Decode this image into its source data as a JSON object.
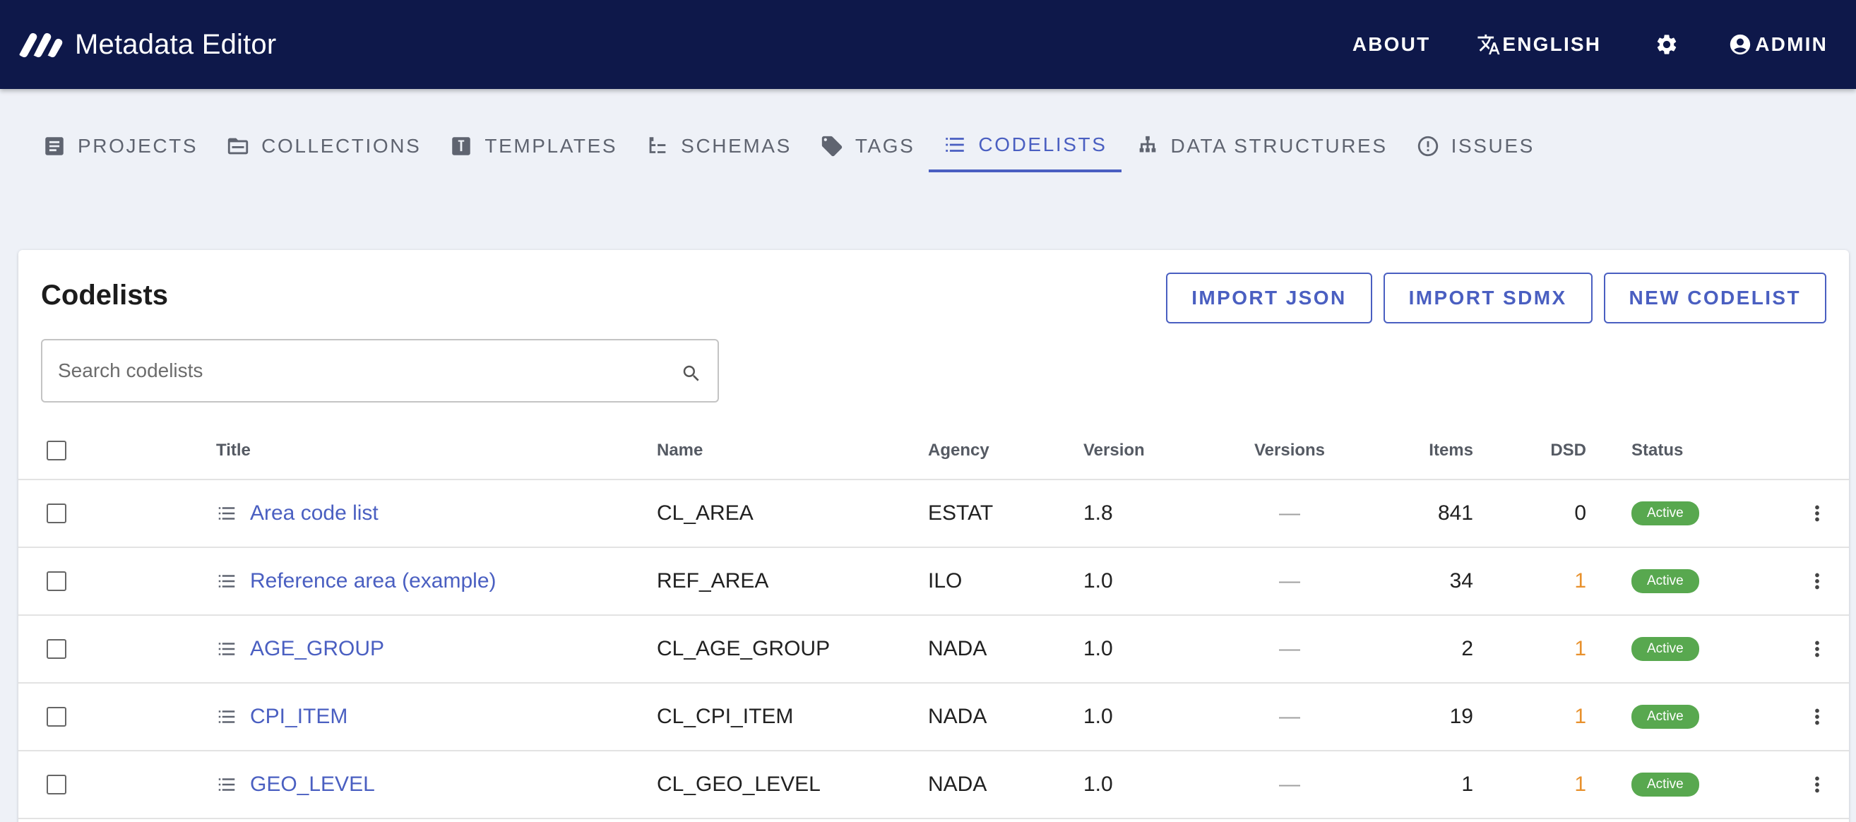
{
  "app": {
    "title": "Metadata Editor"
  },
  "topnav": {
    "about": "ABOUT",
    "language": "ENGLISH",
    "admin": "ADMIN"
  },
  "tabs": [
    {
      "label": "PROJECTS",
      "icon": "document-icon"
    },
    {
      "label": "COLLECTIONS",
      "icon": "folder-icon"
    },
    {
      "label": "TEMPLATES",
      "icon": "template-icon"
    },
    {
      "label": "SCHEMAS",
      "icon": "schema-tree-icon"
    },
    {
      "label": "TAGS",
      "icon": "tag-icon"
    },
    {
      "label": "CODELISTS",
      "icon": "list-icon",
      "active": true
    },
    {
      "label": "DATA STRUCTURES",
      "icon": "hierarchy-icon"
    },
    {
      "label": "ISSUES",
      "icon": "alert-circle-icon"
    }
  ],
  "page": {
    "title": "Codelists",
    "import_json": "IMPORT JSON",
    "import_sdmx": "IMPORT SDMX",
    "new_codelist": "NEW CODELIST",
    "search_placeholder": "Search codelists"
  },
  "table": {
    "headers": {
      "title": "Title",
      "name": "Name",
      "agency": "Agency",
      "version": "Version",
      "versions": "Versions",
      "items": "Items",
      "dsd": "DSD",
      "status": "Status"
    },
    "rows": [
      {
        "title": "Area code list",
        "name": "CL_AREA",
        "agency": "ESTAT",
        "version": "1.8",
        "versions": "—",
        "items": "841",
        "dsd": "0",
        "status": "Active"
      },
      {
        "title": "Reference area (example)",
        "name": "REF_AREA",
        "agency": "ILO",
        "version": "1.0",
        "versions": "—",
        "items": "34",
        "dsd": "1",
        "status": "Active"
      },
      {
        "title": "AGE_GROUP",
        "name": "CL_AGE_GROUP",
        "agency": "NADA",
        "version": "1.0",
        "versions": "—",
        "items": "2",
        "dsd": "1",
        "status": "Active"
      },
      {
        "title": "CPI_ITEM",
        "name": "CL_CPI_ITEM",
        "agency": "NADA",
        "version": "1.0",
        "versions": "—",
        "items": "19",
        "dsd": "1",
        "status": "Active"
      },
      {
        "title": "GEO_LEVEL",
        "name": "CL_GEO_LEVEL",
        "agency": "NADA",
        "version": "1.0",
        "versions": "—",
        "items": "1",
        "dsd": "1",
        "status": "Active"
      }
    ]
  },
  "colors": {
    "topbar": "#0e184a",
    "accent": "#4a5fc1",
    "status_active": "#58a84f",
    "dsd_linked": "#e8912d"
  }
}
